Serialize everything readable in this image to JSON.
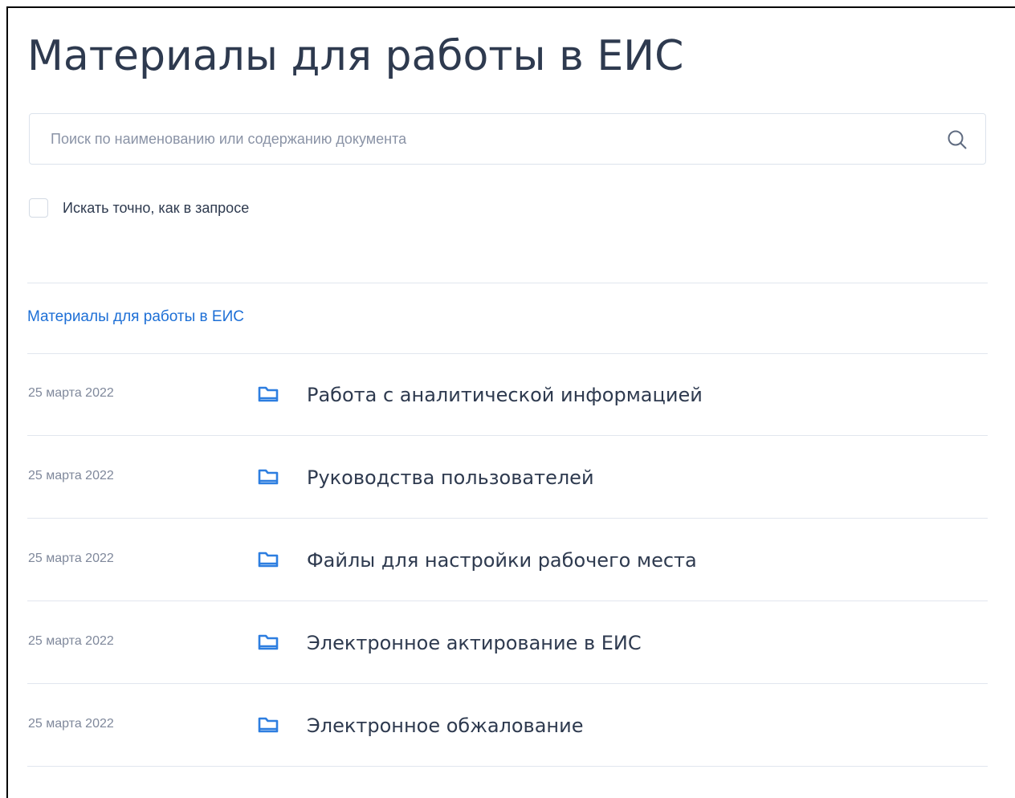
{
  "page": {
    "title": "Материалы для работы в ЕИС"
  },
  "search": {
    "placeholder": "Поиск по наименованию или содержанию документа",
    "value": "",
    "exact_label": "Искать точно, как в запросе",
    "exact_checked": false
  },
  "breadcrumb": {
    "label": "Материалы для работы в ЕИС"
  },
  "items": [
    {
      "date": "25 марта 2022",
      "title": "Работа с аналитической информацией",
      "icon": "folder-icon"
    },
    {
      "date": "25 марта 2022",
      "title": "Руководства пользователей",
      "icon": "folder-icon"
    },
    {
      "date": "25 марта 2022",
      "title": "Файлы для настройки рабочего места",
      "icon": "folder-icon"
    },
    {
      "date": "25 марта 2022",
      "title": "Электронное актирование в ЕИС",
      "icon": "folder-icon"
    },
    {
      "date": "25 марта 2022",
      "title": "Электронное обжалование",
      "icon": "folder-icon"
    }
  ],
  "colors": {
    "accent": "#1d6fd6",
    "text": "#2e3a4f",
    "muted": "#7f889b",
    "divider": "#e1e6ee"
  }
}
